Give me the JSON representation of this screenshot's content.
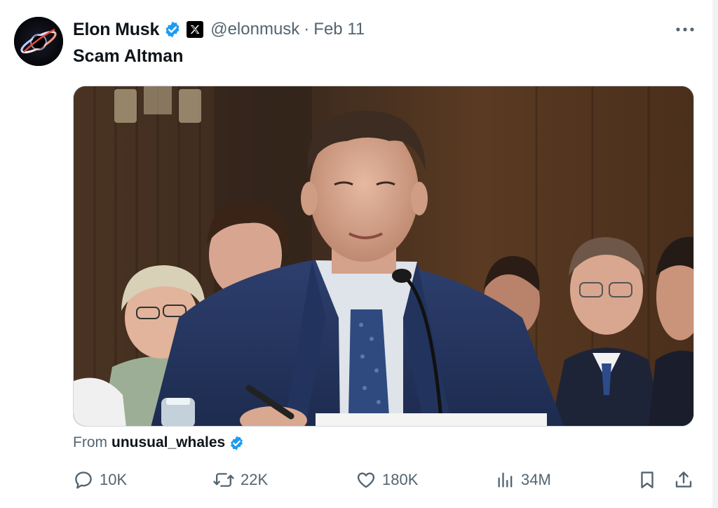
{
  "author": {
    "display_name": "Elon Musk",
    "handle": "@elonmusk",
    "separator": "·",
    "date": "Feb 11",
    "verified_color": "#1d9bf0"
  },
  "tweet": {
    "text": "Scam Altman"
  },
  "media": {
    "kind": "video-still",
    "icon": "hearing-photo"
  },
  "attribution": {
    "prefix": "From",
    "source": "unusual_whales"
  },
  "actions": {
    "reply": {
      "icon": "reply-icon",
      "count": "10K"
    },
    "repost": {
      "icon": "repost-icon",
      "count": "22K"
    },
    "like": {
      "icon": "like-icon",
      "count": "180K"
    },
    "views": {
      "icon": "views-icon",
      "count": "34M"
    },
    "bookmark": {
      "icon": "bookmark-icon"
    },
    "share": {
      "icon": "share-icon"
    }
  },
  "colors": {
    "text_primary": "#0f1419",
    "text_secondary": "#536471",
    "accent": "#1d9bf0"
  }
}
